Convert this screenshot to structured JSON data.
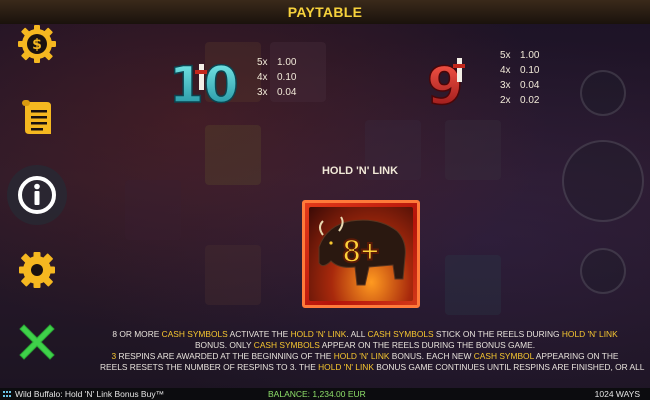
{
  "header": {
    "title": "PAYTABLE"
  },
  "side_menu": {
    "items": [
      {
        "name": "coin-dollar-icon"
      },
      {
        "name": "scroll-icon"
      },
      {
        "name": "info-icon"
      },
      {
        "name": "gear-icon"
      },
      {
        "name": "close-icon"
      }
    ]
  },
  "paytable": {
    "symbols": [
      {
        "glyph": "10",
        "payouts": [
          {
            "mult": "5x",
            "value": "1.00"
          },
          {
            "mult": "4x",
            "value": "0.10"
          },
          {
            "mult": "3x",
            "value": "0.04"
          }
        ]
      },
      {
        "glyph": "9",
        "payouts": [
          {
            "mult": "5x",
            "value": "1.00"
          },
          {
            "mult": "4x",
            "value": "0.10"
          },
          {
            "mult": "3x",
            "value": "0.04"
          },
          {
            "mult": "2x",
            "value": "0.02"
          }
        ]
      }
    ]
  },
  "hold_n_link": {
    "heading": "HOLD 'N' LINK",
    "card_text": "8+",
    "rules": [
      [
        {
          "t": "8 OR MORE ",
          "h": false
        },
        {
          "t": "CASH SYMBOLS",
          "h": true
        },
        {
          "t": " ACTIVATE THE ",
          "h": false
        },
        {
          "t": "HOLD 'N' LINK",
          "h": true
        },
        {
          "t": ". ALL ",
          "h": false
        },
        {
          "t": "CASH SYMBOLS",
          "h": true
        },
        {
          "t": " STICK ON THE REELS DURING ",
          "h": false
        },
        {
          "t": "HOLD 'N' LINK",
          "h": true
        }
      ],
      [
        {
          "t": "BONUS. ONLY ",
          "h": false
        },
        {
          "t": "CASH SYMBOLS",
          "h": true
        },
        {
          "t": " APPEAR ON THE REELS DURING THE BONUS GAME.",
          "h": false
        }
      ],
      [
        {
          "t": "3",
          "h": true
        },
        {
          "t": " RESPINS ARE AWARDED AT THE BEGINNING OF THE ",
          "h": false
        },
        {
          "t": "HOLD 'N' LINK",
          "h": true
        },
        {
          "t": " BONUS. EACH NEW ",
          "h": false
        },
        {
          "t": "CASH SYMBOL",
          "h": true
        },
        {
          "t": " APPEARING ON THE",
          "h": false
        }
      ],
      [
        {
          "t": "REELS RESETS THE NUMBER OF RESPINS TO 3. THE ",
          "h": false
        },
        {
          "t": "HOLD 'N' LINK",
          "h": true
        },
        {
          "t": " BONUS GAME CONTINUES UNTIL RESPINS ARE FINISHED, OR ALL",
          "h": false
        }
      ]
    ]
  },
  "status_bar": {
    "game_name": "Wild Buffalo: Hold 'N' Link Bonus Buy™",
    "balance_label": "BALANCE:",
    "balance_value": "1,234.00 EUR",
    "ways": "1024 WAYS"
  },
  "colors": {
    "accent_yellow": "#f7c730",
    "title_yellow": "#f7d23c",
    "close_green": "#3fd14a",
    "card_red": "#d22a14"
  }
}
